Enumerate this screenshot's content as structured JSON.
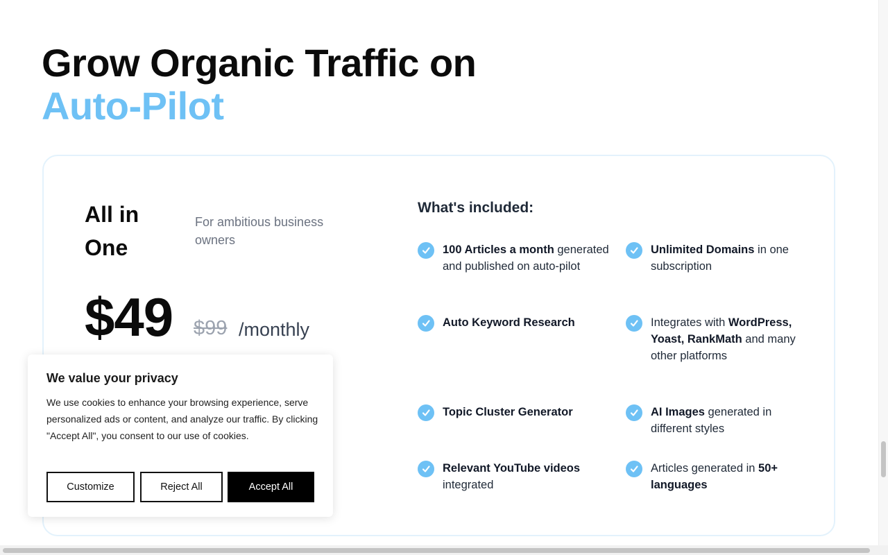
{
  "hero": {
    "title_line1": "Grow Organic Traffic on",
    "title_line2": "Auto-Pilot"
  },
  "plan": {
    "name": "All in One",
    "subtitle": "For ambitious business owners",
    "price": "$49",
    "old_price": "$99",
    "period": "/monthly"
  },
  "included": {
    "title": "What's included:",
    "features": [
      {
        "bold": "100 Articles a month",
        "text": " generated and published on auto-pilot"
      },
      {
        "bold": "Unlimited Domains",
        "text": " in one subscription"
      },
      {
        "bold": "Auto Keyword Research",
        "text": ""
      },
      {
        "pre": "Integrates with ",
        "bold": "WordPress, Yoast, RankMath",
        "text": " and many other platforms"
      },
      {
        "bold": "Topic Cluster Generator",
        "text": ""
      },
      {
        "bold": "AI Images",
        "text": " generated in different styles"
      },
      {
        "bold": "Relevant YouTube videos",
        "text": " integrated"
      },
      {
        "pre": "Articles generated in ",
        "bold": "50+ languages",
        "text": ""
      }
    ]
  },
  "cookie_banner": {
    "title": "We value your privacy",
    "body": "We use cookies to enhance your browsing experience, serve personalized ads or content, and analyze our traffic. By clicking \"Accept All\", you consent to our use of cookies.",
    "customize_label": "Customize",
    "reject_label": "Reject All",
    "accept_label": "Accept All"
  },
  "colors": {
    "accent": "#6ec1f5",
    "card_border": "#e3f2fc"
  }
}
